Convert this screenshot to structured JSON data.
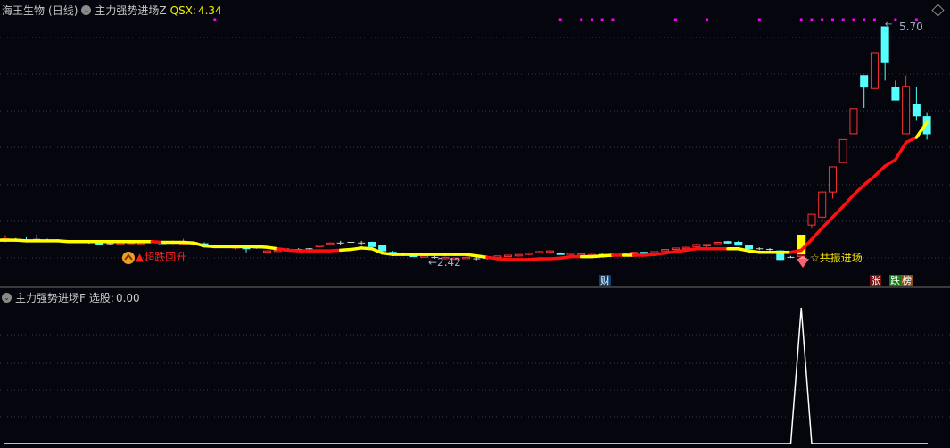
{
  "header": {
    "stock_name": "海王生物",
    "period": "(日线)",
    "indicator_name": "主力强势进场Z",
    "indicator_value_label": "QSX:",
    "indicator_value": "4.34"
  },
  "lower_header": {
    "indicator_name": "主力强势进场F",
    "value_label": "选股:",
    "value": "0.00"
  },
  "annotations": {
    "oversold_rebound": "▲超跌回升",
    "resonance_entry": "☆共振进场",
    "low_price": "←2.42",
    "high_price": "5.70",
    "high_arrow": "←",
    "badge_finance": "财",
    "badge_rise": "张",
    "badge_fall_1": "跌",
    "badge_fall_2": "榜"
  },
  "colors": {
    "up": "#ff3232",
    "down": "#54ffff",
    "doji": "#d0d0d0",
    "line_yellow": "#ffff00",
    "line_red": "#ff1010",
    "signal_dot": "#ff00ff",
    "background": "#05050d"
  },
  "icons": {
    "collapse": "chevron-down-circle-icon",
    "rebound": "up-arrow-coin-icon",
    "entry": "gem-icon",
    "settings": "diamond-icon"
  },
  "price_axis": {
    "max": 5.7,
    "min": 2.42
  },
  "candles": [
    [
      2.73,
      2.8,
      2.7,
      2.75
    ],
    [
      2.74,
      2.76,
      2.72,
      2.74
    ],
    [
      2.73,
      2.77,
      2.7,
      2.72
    ],
    [
      2.74,
      2.81,
      2.7,
      2.74
    ],
    [
      2.73,
      2.75,
      2.71,
      2.71
    ],
    [
      2.71,
      2.73,
      2.7,
      2.71
    ],
    [
      2.7,
      2.72,
      2.69,
      2.72
    ],
    [
      2.71,
      2.73,
      2.7,
      2.71
    ],
    [
      2.7,
      2.73,
      2.68,
      2.7
    ],
    [
      2.72,
      2.73,
      2.69,
      2.67
    ],
    [
      2.68,
      2.7,
      2.66,
      2.68
    ],
    [
      2.68,
      2.7,
      2.67,
      2.69
    ],
    [
      2.69,
      2.72,
      2.68,
      2.7
    ],
    [
      2.68,
      2.7,
      2.66,
      2.69
    ],
    [
      2.7,
      2.72,
      2.69,
      2.7
    ],
    [
      2.7,
      2.72,
      2.68,
      2.69
    ],
    [
      2.7,
      2.71,
      2.68,
      2.7
    ],
    [
      2.67,
      2.75,
      2.66,
      2.71
    ],
    [
      2.69,
      2.72,
      2.66,
      2.7
    ],
    [
      2.68,
      2.7,
      2.64,
      2.65
    ],
    [
      2.64,
      2.66,
      2.63,
      2.64
    ],
    [
      2.63,
      2.64,
      2.62,
      2.63
    ],
    [
      2.62,
      2.66,
      2.6,
      2.64
    ],
    [
      2.65,
      2.66,
      2.56,
      2.61
    ],
    [
      2.62,
      2.64,
      2.61,
      2.62
    ],
    [
      2.57,
      2.59,
      2.56,
      2.58
    ],
    [
      2.58,
      2.6,
      2.57,
      2.59
    ],
    [
      2.6,
      2.62,
      2.59,
      2.58
    ],
    [
      2.6,
      2.62,
      2.59,
      2.6
    ],
    [
      2.61,
      2.62,
      2.6,
      2.61
    ],
    [
      2.64,
      2.66,
      2.63,
      2.66
    ],
    [
      2.68,
      2.7,
      2.67,
      2.69
    ],
    [
      2.69,
      2.72,
      2.66,
      2.69
    ],
    [
      2.7,
      2.71,
      2.68,
      2.7
    ],
    [
      2.69,
      2.72,
      2.66,
      2.69
    ],
    [
      2.7,
      2.71,
      2.65,
      2.64
    ],
    [
      2.65,
      2.66,
      2.6,
      2.58
    ],
    [
      2.56,
      2.58,
      2.55,
      2.54
    ],
    [
      2.55,
      2.56,
      2.53,
      2.55
    ],
    [
      2.53,
      2.55,
      2.52,
      2.5
    ],
    [
      2.5,
      2.52,
      2.49,
      2.51
    ],
    [
      2.49,
      2.51,
      2.47,
      2.49
    ],
    [
      2.48,
      2.5,
      2.46,
      2.49
    ],
    [
      2.47,
      2.49,
      2.46,
      2.48
    ],
    [
      2.48,
      2.5,
      2.47,
      2.49
    ],
    [
      2.47,
      2.49,
      2.45,
      2.47
    ],
    [
      2.48,
      2.5,
      2.46,
      2.48
    ],
    [
      2.49,
      2.51,
      2.48,
      2.51
    ],
    [
      2.5,
      2.52,
      2.49,
      2.52
    ],
    [
      2.51,
      2.53,
      2.5,
      2.53
    ],
    [
      2.54,
      2.56,
      2.52,
      2.55
    ],
    [
      2.56,
      2.58,
      2.55,
      2.57
    ],
    [
      2.57,
      2.59,
      2.56,
      2.58
    ],
    [
      2.55,
      2.56,
      2.53,
      2.53
    ],
    [
      2.54,
      2.55,
      2.52,
      2.55
    ],
    [
      2.53,
      2.55,
      2.52,
      2.54
    ],
    [
      2.52,
      2.54,
      2.51,
      2.53
    ],
    [
      2.53,
      2.55,
      2.52,
      2.51
    ],
    [
      2.52,
      2.54,
      2.51,
      2.53
    ],
    [
      2.52,
      2.54,
      2.51,
      2.54
    ],
    [
      2.55,
      2.57,
      2.54,
      2.56
    ],
    [
      2.56,
      2.57,
      2.54,
      2.53
    ],
    [
      2.54,
      2.56,
      2.53,
      2.57
    ],
    [
      2.58,
      2.6,
      2.57,
      2.6
    ],
    [
      2.6,
      2.62,
      2.59,
      2.62
    ],
    [
      2.62,
      2.64,
      2.61,
      2.63
    ],
    [
      2.64,
      2.68,
      2.63,
      2.67
    ],
    [
      2.65,
      2.67,
      2.63,
      2.67
    ],
    [
      2.69,
      2.71,
      2.68,
      2.7
    ],
    [
      2.71,
      2.72,
      2.68,
      2.69
    ],
    [
      2.7,
      2.72,
      2.66,
      2.66
    ],
    [
      2.65,
      2.66,
      2.61,
      2.61
    ],
    [
      2.61,
      2.63,
      2.59,
      2.61
    ],
    [
      2.6,
      2.62,
      2.58,
      2.6
    ],
    [
      2.58,
      2.59,
      2.45,
      2.46
    ],
    [
      2.49,
      2.51,
      2.48,
      2.49
    ],
    [
      2.5,
      2.53,
      2.49,
      2.52
    ],
    [
      2.94,
      3.09,
      2.89,
      3.09
    ],
    [
      3.05,
      3.4,
      2.99,
      3.4
    ],
    [
      3.4,
      3.75,
      3.31,
      3.75
    ],
    [
      3.81,
      4.13,
      3.81,
      4.13
    ],
    [
      4.21,
      4.56,
      4.21,
      4.56
    ],
    [
      5.02,
      5.02,
      4.57,
      4.86
    ],
    [
      4.84,
      5.34,
      4.84,
      5.34
    ],
    [
      5.7,
      5.7,
      4.95,
      5.2
    ],
    [
      4.86,
      4.95,
      4.68,
      4.68
    ],
    [
      4.21,
      5.02,
      4.21,
      4.87
    ],
    [
      4.62,
      4.86,
      4.39,
      4.46
    ],
    [
      4.45,
      4.5,
      4.13,
      4.21
    ]
  ],
  "indicator_line": [
    2.73,
    2.73,
    2.72,
    2.72,
    2.72,
    2.72,
    2.71,
    2.71,
    2.71,
    2.71,
    2.71,
    2.71,
    2.71,
    2.71,
    2.71,
    2.7,
    2.7,
    2.7,
    2.69,
    2.65,
    2.64,
    2.64,
    2.64,
    2.64,
    2.64,
    2.63,
    2.61,
    2.59,
    2.58,
    2.58,
    2.58,
    2.58,
    2.59,
    2.6,
    2.62,
    2.61,
    2.55,
    2.53,
    2.53,
    2.53,
    2.53,
    2.53,
    2.53,
    2.53,
    2.53,
    2.51,
    2.49,
    2.47,
    2.46,
    2.46,
    2.46,
    2.47,
    2.47,
    2.48,
    2.5,
    2.5,
    2.5,
    2.51,
    2.52,
    2.52,
    2.52,
    2.52,
    2.53,
    2.55,
    2.57,
    2.59,
    2.61,
    2.61,
    2.61,
    2.61,
    2.61,
    2.58,
    2.56,
    2.56,
    2.56,
    2.56,
    2.59,
    2.74,
    2.9,
    3.05,
    3.2,
    3.36,
    3.5,
    3.62,
    3.76,
    3.85,
    4.09,
    4.16,
    4.37
  ],
  "indicator_line_colors": "RYYYYYYYYYYYYYYRYYYYYYYYYYYRRRRRRYYYYYYYYYYYYYYRRRRRRRRRYYYRYRRRRRRRRRYYYYYYRRRRRRRRRRRRY",
  "signal_dots": [
    20,
    53,
    55,
    56,
    57,
    58,
    64,
    67,
    72,
    76,
    77,
    78,
    79,
    80,
    81,
    82,
    83,
    85,
    87
  ],
  "entry_bar_index": 76,
  "lower_series": [
    0,
    0,
    0,
    0,
    0,
    0,
    0,
    0,
    0,
    0,
    0,
    0,
    0,
    0,
    0,
    0,
    0,
    0,
    0,
    0,
    0,
    0,
    0,
    0,
    0,
    0,
    0,
    0,
    0,
    0,
    0,
    0,
    0,
    0,
    0,
    0,
    0,
    0,
    0,
    0,
    0,
    0,
    0,
    0,
    0,
    0,
    0,
    0,
    0,
    0,
    0,
    0,
    0,
    0,
    0,
    0,
    0,
    0,
    0,
    0,
    0,
    0,
    0,
    0,
    0,
    0,
    0,
    0,
    0,
    0,
    0,
    0,
    0,
    0,
    0,
    0,
    1,
    0,
    0,
    0,
    0,
    0,
    0,
    0,
    0,
    0,
    0,
    0,
    0
  ]
}
